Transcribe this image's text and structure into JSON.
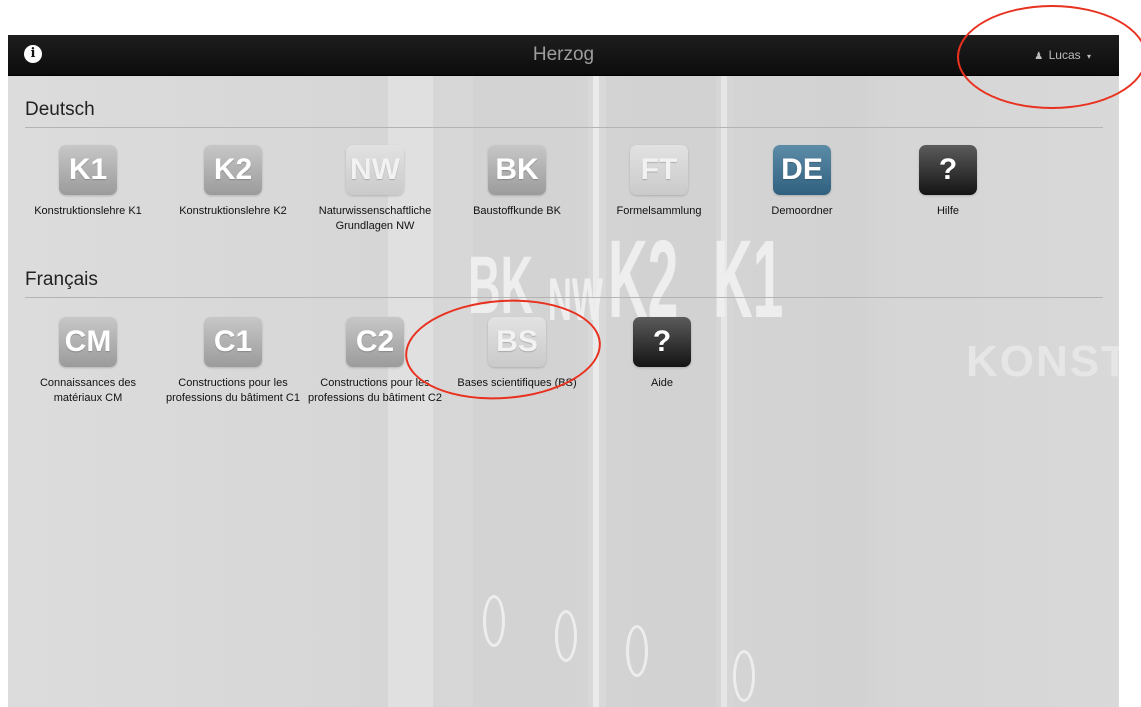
{
  "navbar": {
    "title": "Herzog",
    "info_icon": "i",
    "user_icon": "user-icon",
    "user_glyph": "♟",
    "user_name": "Lucas",
    "caret_glyph": "▾"
  },
  "background": {
    "letters": [
      "BK",
      "NW",
      "K2",
      "K1"
    ],
    "side_text": "KONST"
  },
  "sections": {
    "deutsch": {
      "heading": "Deutsch",
      "tiles": [
        {
          "icon": "K1",
          "label": "Konstruktionslehre K1"
        },
        {
          "icon": "K2",
          "label": "Konstruktionslehre K2"
        },
        {
          "icon": "NW",
          "label": "Naturwissenschaftliche Grundlagen NW"
        },
        {
          "icon": "BK",
          "label": "Baustoffkunde BK"
        },
        {
          "icon": "FT",
          "label": "Formelsammlung"
        },
        {
          "icon": "DE",
          "label": "Demoordner"
        },
        {
          "icon": "?",
          "label": "Hilfe"
        }
      ]
    },
    "francais": {
      "heading": "Français",
      "tiles": [
        {
          "icon": "CM",
          "label": "Connaissances des matériaux CM"
        },
        {
          "icon": "C1",
          "label": "Constructions pour les professions du bâtiment C1"
        },
        {
          "icon": "C2",
          "label": "Constructions pour les professions du bâtiment C2"
        },
        {
          "icon": "BS",
          "label": "Bases scientifiques (BS)"
        },
        {
          "icon": "?",
          "label": "Aide"
        }
      ]
    }
  },
  "colors": {
    "annotation": "#e8321f",
    "navbar": "#111111",
    "demo_icon": "#3a6b88"
  }
}
